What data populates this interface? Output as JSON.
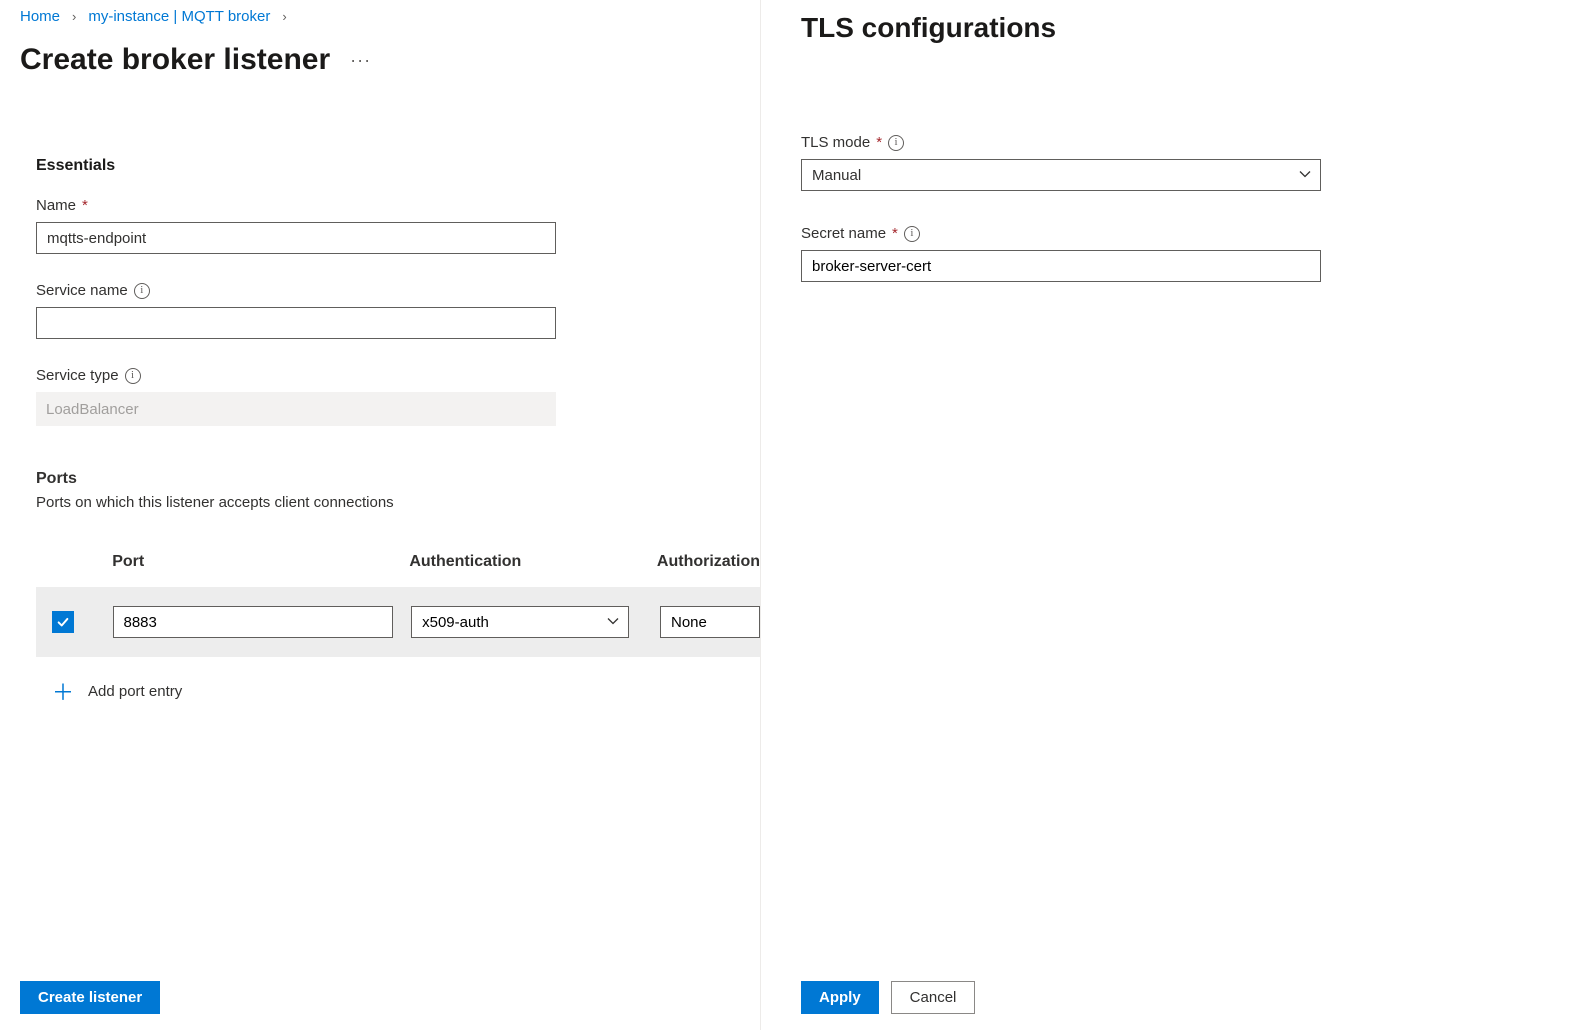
{
  "breadcrumb": {
    "home": "Home",
    "instance": "my-instance | MQTT broker"
  },
  "page_title": "Create broker listener",
  "essentials": {
    "heading": "Essentials",
    "name_label": "Name",
    "name_value": "mqtts-endpoint",
    "service_name_label": "Service name",
    "service_name_value": "",
    "service_type_label": "Service type",
    "service_type_value": "LoadBalancer"
  },
  "ports": {
    "heading": "Ports",
    "description": "Ports on which this listener accepts client connections",
    "columns": {
      "port": "Port",
      "auth": "Authentication",
      "authz": "Authorization"
    },
    "rows": [
      {
        "checked": true,
        "port": "8883",
        "auth": "x509-auth",
        "authz": "None"
      }
    ],
    "add_label": "Add port entry"
  },
  "footer": {
    "create": "Create listener"
  },
  "tls_panel": {
    "title": "TLS configurations",
    "mode_label": "TLS mode",
    "mode_value": "Manual",
    "secret_label": "Secret name",
    "secret_value": "broker-server-cert",
    "apply": "Apply",
    "cancel": "Cancel"
  }
}
